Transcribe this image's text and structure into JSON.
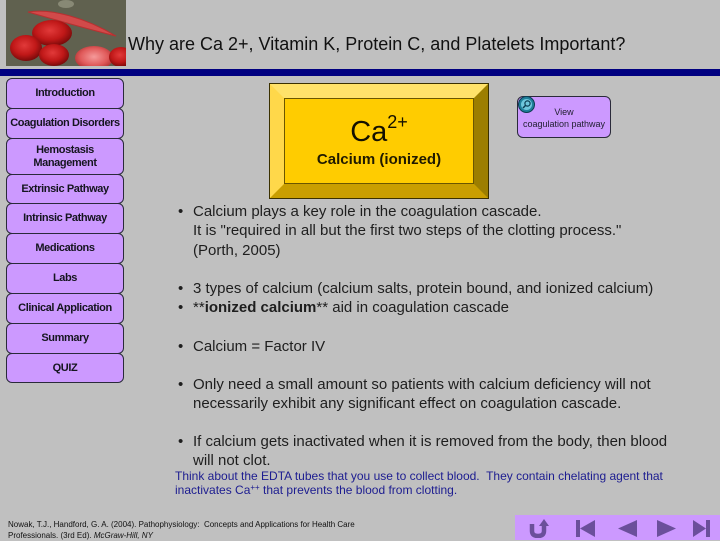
{
  "header": {
    "title": "Why are Ca 2+, Vitamin K, Protein C, and Platelets Important?",
    "image_description": "red blood cells and sickle cell micrograph"
  },
  "sidebar": {
    "items": [
      {
        "label": "Introduction"
      },
      {
        "label": "Coagulation Disorders"
      },
      {
        "label": "Hemostasis\nManagement"
      },
      {
        "label": "Extrinsic Pathway"
      },
      {
        "label": "Intrinsic Pathway"
      },
      {
        "label": "Medications"
      },
      {
        "label": "Labs"
      },
      {
        "label": "Clinical Application"
      },
      {
        "label": "Summary"
      },
      {
        "label": "QUIZ"
      }
    ]
  },
  "feature_box": {
    "symbol": "Ca",
    "superscript": "2+",
    "caption": "Calcium (ionized)"
  },
  "view_button": {
    "icon": "magnifier-icon",
    "line1": "View",
    "line2": "coagulation pathway"
  },
  "main": {
    "bullet_glyph": "•",
    "bullets": [
      {
        "lines": [
          "Calcium plays a key role in the coagulation cascade.",
          "It is \"required in all but the first two steps of the clotting process.\"",
          "(Porth, 2005)"
        ]
      },
      {
        "lines": [
          "3 types of calcium (calcium salts, protein bound, and ionized calcium)"
        ]
      },
      {
        "segments": {
          "prefix": "**",
          "bold": "ionized calcium",
          "suffix": "** aid in coagulation cascade"
        }
      },
      {
        "lines": [
          "Calcium = Factor IV"
        ]
      },
      {
        "lines": [
          "Only need a small amount so patients with calcium deficiency will not",
          "necessarily exhibit any significant effect on coagulation cascade."
        ]
      },
      {
        "lines": [
          "If calcium gets inactivated when it is removed from the body, then blood",
          "will not clot."
        ]
      }
    ],
    "note": {
      "line1": "Think about the EDTA tubes that you use to collect blood.  They contain chelating agent that",
      "line2_prefix": "inactivates Ca",
      "line2_sup": "++",
      "line2_suffix": " that prevents the blood from clotting."
    }
  },
  "reference": {
    "line1": "Nowak, T.J., Handford, G. A. (2004). Pathophysiology:  Concepts and Applications for Health Care",
    "line2": "Professionals. (3rd Ed). ",
    "line2_italic": "McGraw-Hill, NY"
  },
  "nav": {
    "buttons": [
      {
        "name": "return",
        "icon": "return-icon"
      },
      {
        "name": "first",
        "icon": "first-slide-icon"
      },
      {
        "name": "previous",
        "icon": "previous-slide-icon"
      },
      {
        "name": "next",
        "icon": "next-slide-icon"
      },
      {
        "name": "last",
        "icon": "last-slide-icon"
      }
    ]
  },
  "colors": {
    "background": "#C0C0C0",
    "rule": "#000080",
    "button_fill": "#CC99FF",
    "feature_fill": "#FFCC00",
    "nav_icon": "#6B4F9B",
    "note_text": "#1C1C90"
  }
}
